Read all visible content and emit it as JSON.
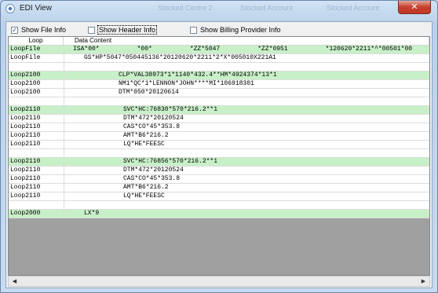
{
  "window": {
    "title": "EDI View",
    "ghost_titles": [
      "Stocked Centre 2",
      "Stocked Account",
      "Stocked Account"
    ],
    "close_glyph": "✕"
  },
  "options": {
    "show_file_info": {
      "label": "Show File Info",
      "checked": true
    },
    "show_header_info": {
      "label": "Show Header Info",
      "checked": false
    },
    "show_billing_provider_info": {
      "label": "Show Billing Provider Info",
      "checked": false
    }
  },
  "grid": {
    "columns": [
      "Loop",
      "Data Content"
    ],
    "rows": [
      {
        "loop": "LoopFile",
        "content": "ISA*00*          *00*          *ZZ*5047          *ZZ*0951          *120620*2211*^*00501*00",
        "indent": 1,
        "highlight": true
      },
      {
        "loop": "LoopFile",
        "content": "GS*HP*5047*050445136*20120620*2211*2*X*005010X221A1",
        "indent": 2,
        "highlight": false
      },
      {
        "loop": "",
        "content": "",
        "indent": 0,
        "highlight": false
      },
      {
        "loop": "Loop2100",
        "content": "CLP*VAL38973*1*1140*432.4**HM*4924374*13*1",
        "indent": 3,
        "highlight": true
      },
      {
        "loop": "Loop2100",
        "content": "NM1*QC*1*LENNON*JOHN****MI*106918301",
        "indent": 3,
        "highlight": false
      },
      {
        "loop": "Loop2100",
        "content": "DTM*050*20120614",
        "indent": 3,
        "highlight": false
      },
      {
        "loop": "",
        "content": "",
        "indent": 0,
        "highlight": false
      },
      {
        "loop": "Loop2110",
        "content": "SVC*HC:76830*570*216.2**1",
        "indent": 4,
        "highlight": true
      },
      {
        "loop": "Loop2110",
        "content": "DTM*472*20120524",
        "indent": 4,
        "highlight": false
      },
      {
        "loop": "Loop2110",
        "content": "CAS*CO*45*353.8",
        "indent": 4,
        "highlight": false
      },
      {
        "loop": "Loop2110",
        "content": "AMT*B6*216.2",
        "indent": 4,
        "highlight": false
      },
      {
        "loop": "Loop2110",
        "content": "LQ*HE*FEESC",
        "indent": 4,
        "highlight": false
      },
      {
        "loop": "",
        "content": "",
        "indent": 0,
        "highlight": false
      },
      {
        "loop": "Loop2110",
        "content": "SVC*HC:76856*570*216.2**1",
        "indent": 4,
        "highlight": true
      },
      {
        "loop": "Loop2110",
        "content": "DTM*472*20120524",
        "indent": 4,
        "highlight": false
      },
      {
        "loop": "Loop2110",
        "content": "CAS*CO*45*353.8",
        "indent": 4,
        "highlight": false
      },
      {
        "loop": "Loop2110",
        "content": "AMT*B6*216.2",
        "indent": 4,
        "highlight": false
      },
      {
        "loop": "Loop2110",
        "content": "LQ*HE*FEESC",
        "indent": 4,
        "highlight": false
      },
      {
        "loop": "",
        "content": "",
        "indent": 0,
        "highlight": false
      },
      {
        "loop": "Loop2000",
        "content": "LX*9",
        "indent": 2,
        "highlight": true
      }
    ]
  },
  "scrollbar": {
    "left_glyph": "◀",
    "right_glyph": "▶"
  }
}
